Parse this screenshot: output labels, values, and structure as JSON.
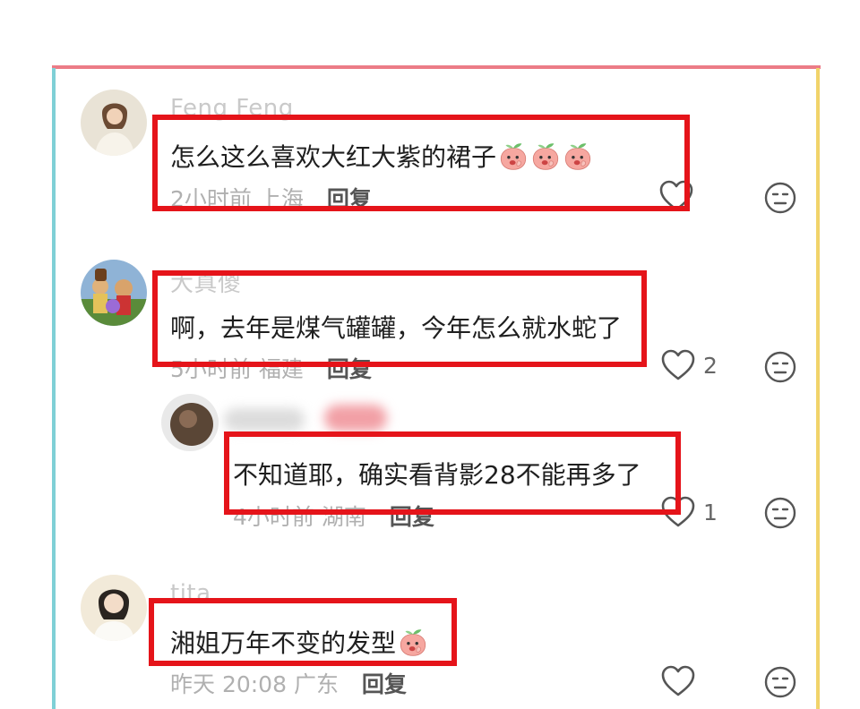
{
  "comments": [
    {
      "username": "Feng Feng",
      "text": "怎么这么喜欢大红大紫的裙子",
      "emoji": [
        "peach-icon",
        "peach-icon",
        "peach-icon"
      ],
      "time": "2小时前",
      "location": "上海",
      "reply_label": "回复",
      "like_count": ""
    },
    {
      "username": "大真傻",
      "text": "啊，去年是煤气罐罐，今年怎么就水蛇了",
      "time": "5小时前",
      "location": "福建",
      "reply_label": "回复",
      "like_count": "2"
    },
    {
      "username": "",
      "text": "不知道耶，确实看背影28不能再多了",
      "time": "4小时前",
      "location": "湖南",
      "reply_label": "回复",
      "like_count": "1"
    },
    {
      "username": "tita",
      "text": "湘姐万年不变的发型",
      "emoji": [
        "peach-icon"
      ],
      "time": "昨天 20:08",
      "location": "广东",
      "reply_label": "回复",
      "like_count": ""
    }
  ],
  "colors": {
    "highlight": "#e5141a",
    "frame_top": "#ec7c87",
    "frame_left": "#7fd0d6",
    "frame_right": "#f1d36a"
  }
}
